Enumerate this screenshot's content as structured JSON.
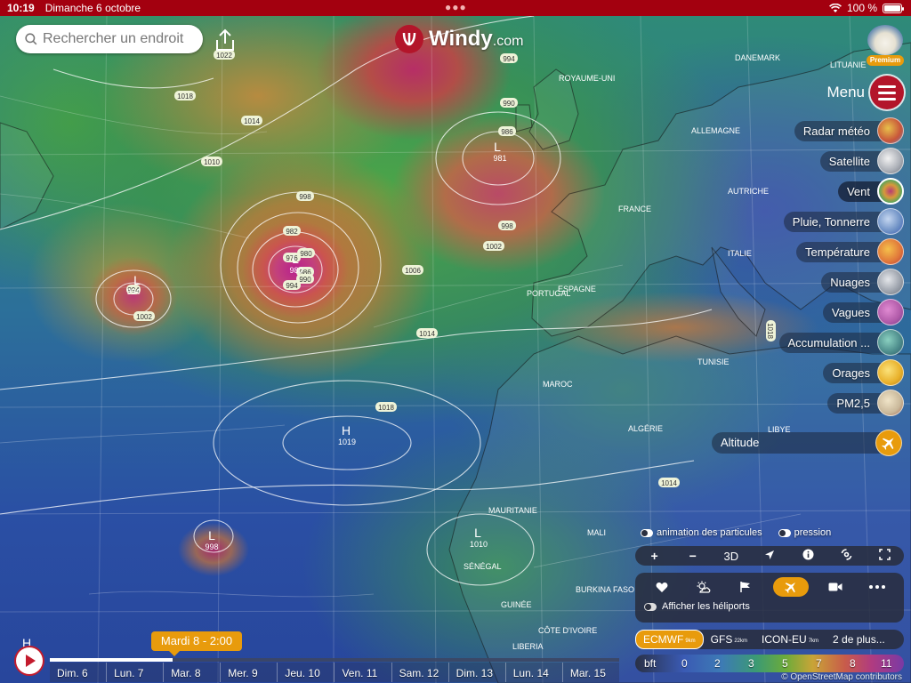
{
  "status_bar": {
    "time": "10:19",
    "date": "Dimanche 6 octobre",
    "battery": "100 %"
  },
  "search": {
    "placeholder": "Rechercher un endroit"
  },
  "logo": {
    "brand": "Windy",
    "suffix": ".com"
  },
  "premium": {
    "label": "Premium"
  },
  "menu": {
    "label": "Menu"
  },
  "layers": [
    {
      "label": "Radar météo",
      "icon": "radar-icon",
      "color": "#d9843a"
    },
    {
      "label": "Satellite",
      "icon": "satellite-icon",
      "color": "#b9bcc2"
    },
    {
      "label": "Vent",
      "icon": "wind-icon",
      "color": "#c7a03a",
      "active": true
    },
    {
      "label": "Pluie, Tonnerre",
      "icon": "rain-icon",
      "color": "#7a9ac4"
    },
    {
      "label": "Température",
      "icon": "temperature-icon",
      "color": "#e5893a"
    },
    {
      "label": "Nuages",
      "icon": "clouds-icon",
      "color": "#9aa0aa"
    },
    {
      "label": "Vagues",
      "icon": "waves-icon",
      "color": "#b05aa8"
    },
    {
      "label": "Accumulation ...",
      "icon": "accumulation-icon",
      "color": "#4b8a8a"
    },
    {
      "label": "Orages",
      "icon": "thunderstorm-icon",
      "color": "#e8b02a"
    },
    {
      "label": "PM2,5",
      "icon": "pm25-icon",
      "color": "#c9b89a"
    }
  ],
  "altitude": {
    "label": "Altitude"
  },
  "map_labels": {
    "countries": [
      "ROYAUME-UNI",
      "ALLEMAGNE",
      "FRANCE",
      "AUTRICHE",
      "ITALIE",
      "PORTUGAL",
      "ESPAGNE",
      "TUNISIE",
      "MAROC",
      "ALGÉRIE",
      "LIBYE",
      "MAURITANIE",
      "MALI",
      "SÉNÉGAL",
      "GUINÉE",
      "CÔTE D'IVOIRE",
      "LIBERIA",
      "BURKINA FASO",
      "LITUANIE",
      "DANEMARK"
    ],
    "pressure_values": [
      "1022",
      "1018",
      "1014",
      "1010",
      "998",
      "982",
      "980",
      "976",
      "986",
      "990",
      "994",
      "1002",
      "1006",
      "1014",
      "998",
      "1002",
      "986",
      "990",
      "994",
      "1018",
      "1014",
      "1018",
      "994"
    ],
    "systems": [
      {
        "letter": "L",
        "value": "981"
      },
      {
        "letter": "L",
        "value": "980"
      },
      {
        "letter": "L",
        "value": "994"
      },
      {
        "letter": "H",
        "value": "1019"
      },
      {
        "letter": "L",
        "value": "998"
      },
      {
        "letter": "L",
        "value": "1010"
      },
      {
        "letter": "H",
        "value": ""
      }
    ]
  },
  "toggles": {
    "particles": "animation des particules",
    "pressure": "pression"
  },
  "controls": {
    "zoom_in": "+",
    "zoom_out": "−",
    "three_d": "3D"
  },
  "poi": {
    "heliports": "Afficher les héliports"
  },
  "models": [
    {
      "name": "ECMWF",
      "res": "9km",
      "selected": true
    },
    {
      "name": "GFS",
      "res": "22km"
    },
    {
      "name": "ICON-EU",
      "res": "7km"
    },
    {
      "name": "2 de plus...",
      "res": ""
    }
  ],
  "scale": {
    "unit": "bft",
    "ticks": [
      "0",
      "2",
      "3",
      "5",
      "7",
      "8",
      "11"
    ]
  },
  "attribution": "© OpenStreetMap contributors",
  "timeline": {
    "current": "Mardi 8 - 2:00",
    "progress": 0.215,
    "days": [
      "Dim. 6",
      "Lun. 7",
      "Mar. 8",
      "Mer. 9",
      "Jeu. 10",
      "Ven. 11",
      "Sam. 12",
      "Dim. 13",
      "Lun. 14",
      "Mar. 15"
    ]
  }
}
